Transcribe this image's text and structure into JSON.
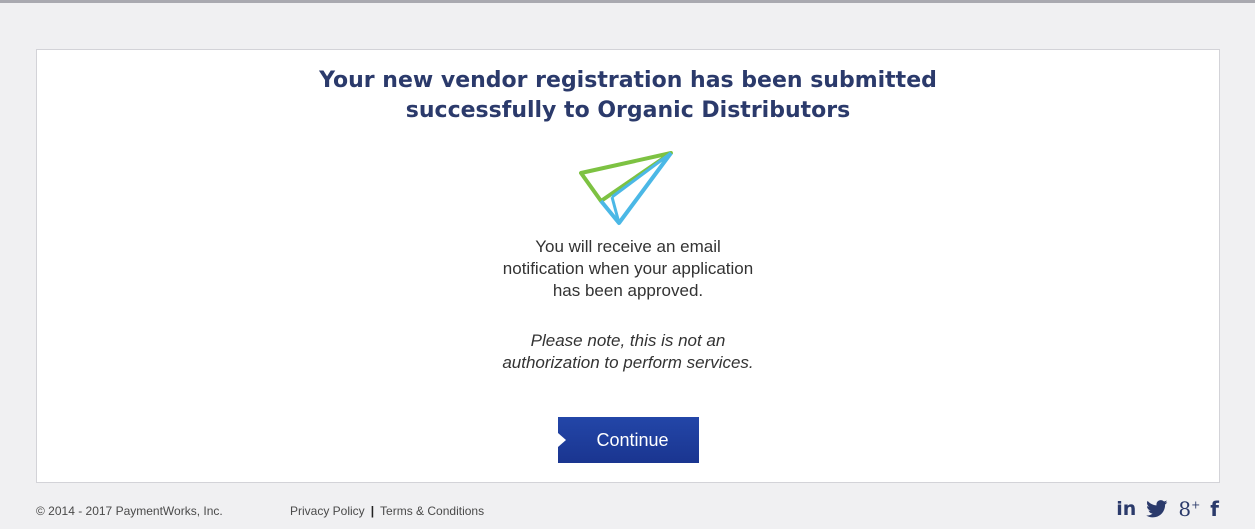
{
  "confirmation": {
    "headline_line1": "Your new vendor registration has been submitted",
    "headline_line2": "successfully to Organic Distributors",
    "message_line1": "You will receive an email",
    "message_line2": "notification when your application",
    "message_line3": "has been approved.",
    "note_line1": "Please note, this is not an",
    "note_line2": "authorization to perform services.",
    "continue_label": "Continue",
    "illustration_icon": "paper-plane-icon"
  },
  "footer": {
    "copyright": "© 2014 - 2017 PaymentWorks, Inc.",
    "privacy_label": "Privacy Policy",
    "separator": "|",
    "terms_label": "Terms & Conditions",
    "social": {
      "linkedin": "in",
      "gplus": "8",
      "gplus_sup": "+",
      "facebook": "f"
    }
  },
  "colors": {
    "headline": "#2b3a6b",
    "button": "#1f3f9f",
    "plane_green": "#7dc242",
    "plane_blue": "#4bb8e6",
    "page_bg": "#f0f0f2"
  }
}
